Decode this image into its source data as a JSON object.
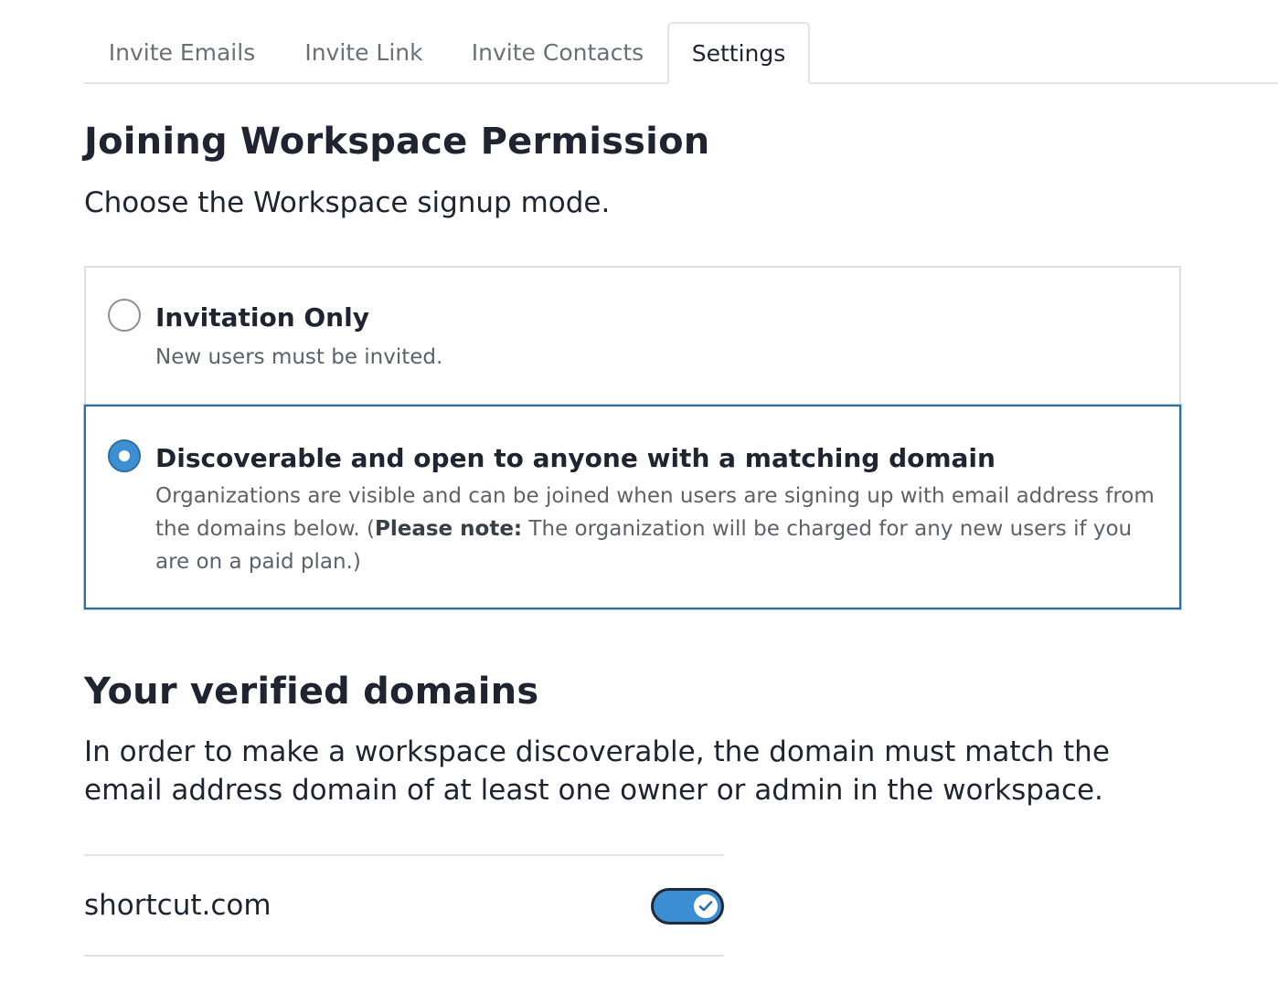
{
  "tabs": [
    {
      "label": "Invite Emails",
      "active": false
    },
    {
      "label": "Invite Link",
      "active": false
    },
    {
      "label": "Invite Contacts",
      "active": false
    },
    {
      "label": "Settings",
      "active": true
    }
  ],
  "permission": {
    "title": "Joining Workspace Permission",
    "subtitle": "Choose the Workspace signup mode.",
    "options": [
      {
        "label": "Invitation Only",
        "description": "New users must be invited.",
        "selected": false
      },
      {
        "label": "Discoverable and open to anyone with a matching domain",
        "description_prefix": "Organizations are visible and can be joined when users are signing up with email address from the domains below. (",
        "description_note_label": "Please note:",
        "description_suffix": " The organization will be charged for any new users if you are on a paid plan.)",
        "selected": true
      }
    ]
  },
  "domains": {
    "title": "Your verified domains",
    "description": "In order to make a workspace discoverable, the domain must match the email address domain of at least one owner or admin in the workspace.",
    "items": [
      {
        "name": "shortcut.com",
        "enabled": true,
        "toggle_icon": "check-icon"
      }
    ]
  },
  "colors": {
    "accent": "#3b8ed2",
    "selected_border": "#2f6f9f",
    "text": "#1f2430",
    "muted": "#6b6f76"
  }
}
